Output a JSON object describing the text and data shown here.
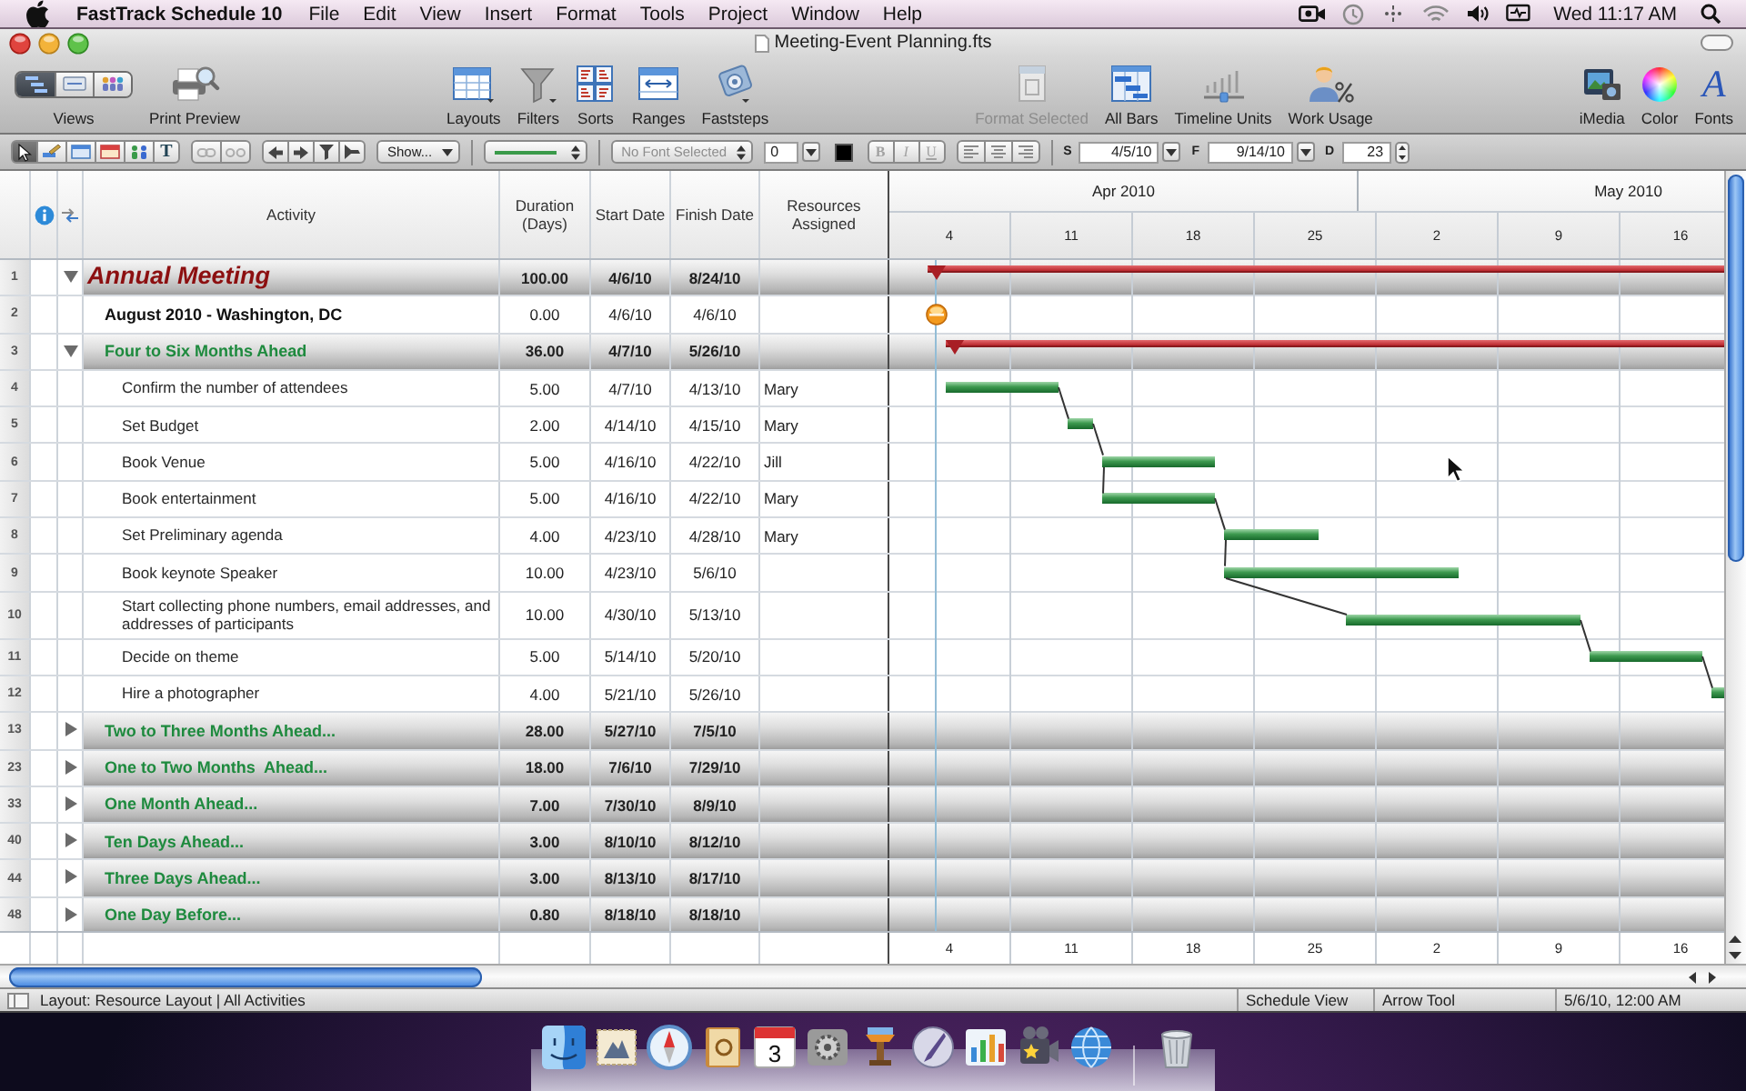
{
  "menu_bar": {
    "app_name": "FastTrack Schedule 10",
    "menus": [
      "File",
      "Edit",
      "View",
      "Insert",
      "Format",
      "Tools",
      "Project",
      "Window",
      "Help"
    ],
    "clock": "Wed 11:17 AM"
  },
  "window": {
    "title": "Meeting-Event Planning.fts"
  },
  "toolbar": {
    "groups": [
      {
        "items": [
          {
            "kind": "views",
            "label": "Views",
            "segments": [
              {
                "kind": "gantt",
                "selected": true
              },
              {
                "kind": "cards",
                "selected": false
              },
              {
                "kind": "people",
                "selected": false
              }
            ]
          },
          {
            "kind": "print",
            "label": "Print Preview"
          }
        ]
      },
      {
        "items": [
          {
            "kind": "layouts",
            "label": "Layouts"
          },
          {
            "kind": "filters",
            "label": "Filters"
          },
          {
            "kind": "sorts",
            "label": "Sorts"
          },
          {
            "kind": "ranges",
            "label": "Ranges"
          },
          {
            "kind": "faststeps",
            "label": "Faststeps"
          }
        ]
      },
      {
        "items": [
          {
            "kind": "format",
            "label": "Format Selected",
            "disabled": true
          },
          {
            "kind": "bars",
            "label": "All Bars",
            "disabled": false
          },
          {
            "kind": "timeline",
            "label": "Timeline Units",
            "disabled": false
          },
          {
            "kind": "usage",
            "label": "Work Usage",
            "disabled": false
          }
        ]
      },
      {
        "items": [
          {
            "kind": "media",
            "label": "iMedia"
          },
          {
            "kind": "color",
            "label": "Color"
          },
          {
            "kind": "fonts",
            "label": "Fonts",
            "glyph": "A"
          }
        ]
      }
    ]
  },
  "format_bar": {
    "tools": [
      {
        "kind": "pointer",
        "selected": true
      },
      {
        "kind": "pen",
        "selected": false
      },
      {
        "kind": "card",
        "selected": false
      },
      {
        "kind": "flag",
        "selected": false
      },
      {
        "kind": "people",
        "selected": false
      },
      {
        "kind": "text",
        "glyph": "T",
        "selected": false
      }
    ],
    "link_buttons": [
      {
        "kind": "link",
        "disabled": true
      },
      {
        "kind": "unlink",
        "disabled": true
      }
    ],
    "nav_buttons": [
      {
        "kind": "left"
      },
      {
        "kind": "right"
      },
      {
        "kind": "filter-down"
      },
      {
        "kind": "filter-right"
      }
    ],
    "show_menu": "Show...",
    "font_menu": "No Font Selected",
    "font_size": "0",
    "style_buttons": [
      {
        "kind": "bold",
        "label": "B",
        "disabled": true
      },
      {
        "kind": "italic",
        "label": "I",
        "disabled": true
      },
      {
        "kind": "underline",
        "label": "U",
        "disabled": true
      }
    ],
    "align_buttons": [
      {
        "kind": "left"
      },
      {
        "kind": "center"
      },
      {
        "kind": "right"
      }
    ],
    "date_fields": [
      {
        "kind": "date",
        "label": "S",
        "value": "4/5/10"
      },
      {
        "kind": "date",
        "label": "F",
        "value": "9/14/10"
      },
      {
        "kind": "number",
        "label": "D",
        "value": "23"
      }
    ]
  },
  "schedule": {
    "columns": [
      "Activity",
      "Duration (Days)",
      "Start Date",
      "Finish Date",
      "Resources Assigned"
    ],
    "timeline": {
      "months": [
        "Apr 2010",
        "May 2010"
      ],
      "weeks": [
        "4",
        "11",
        "18",
        "25",
        "2",
        "9",
        "16"
      ]
    },
    "rows": [
      {
        "number": "1",
        "kind": "project",
        "expanded": true,
        "activity": "Annual Meeting",
        "duration": "100.00",
        "start": "4/6/10",
        "finish": "8/24/10",
        "children": [
          {
            "number": "2",
            "kind": "milestone",
            "activity": "August 2010 - Washington, DC",
            "duration": "0.00",
            "start": "4/6/10",
            "finish": "4/6/10"
          },
          {
            "number": "3",
            "kind": "summary",
            "expanded": true,
            "activity": "Four to Six Months Ahead",
            "duration": "36.00",
            "start": "4/7/10",
            "finish": "5/26/10",
            "children": [
              {
                "number": "4",
                "kind": "task",
                "linked": false,
                "activity": "Confirm the number of attendees",
                "duration": "5.00",
                "start": "4/7/10",
                "finish": "4/13/10",
                "resource": "Mary"
              },
              {
                "number": "5",
                "kind": "task",
                "linked": true,
                "activity": "Set Budget",
                "duration": "2.00",
                "start": "4/14/10",
                "finish": "4/15/10",
                "resource": "Mary"
              },
              {
                "number": "6",
                "kind": "task",
                "linked": true,
                "activity": "Book Venue",
                "duration": "5.00",
                "start": "4/16/10",
                "finish": "4/22/10",
                "resource": "Jill"
              },
              {
                "number": "7",
                "kind": "task",
                "linked": true,
                "activity": "Book entertainment",
                "duration": "5.00",
                "start": "4/16/10",
                "finish": "4/22/10",
                "resource": "Mary"
              },
              {
                "number": "8",
                "kind": "task",
                "linked": true,
                "activity": "Set Preliminary agenda",
                "duration": "4.00",
                "start": "4/23/10",
                "finish": "4/28/10",
                "resource": "Mary"
              },
              {
                "number": "9",
                "kind": "task",
                "linked": true,
                "activity": "Book keynote Speaker",
                "duration": "10.00",
                "start": "4/23/10",
                "finish": "5/6/10"
              },
              {
                "number": "10",
                "kind": "task",
                "linked": true,
                "activity": "Start collecting phone numbers, email addresses, and addresses of participants",
                "duration": "10.00",
                "start": "4/30/10",
                "finish": "5/13/10"
              },
              {
                "number": "11",
                "kind": "task",
                "linked": true,
                "activity": "Decide on theme",
                "duration": "5.00",
                "start": "5/14/10",
                "finish": "5/20/10"
              },
              {
                "number": "12",
                "kind": "task",
                "linked": true,
                "activity": "Hire a photographer",
                "duration": "4.00",
                "start": "5/21/10",
                "finish": "5/26/10"
              }
            ]
          },
          {
            "number": "13",
            "kind": "summary",
            "expanded": false,
            "activity": "Two to Three Months Ahead...",
            "duration": "28.00",
            "start": "5/27/10",
            "finish": "7/5/10"
          },
          {
            "number": "23",
            "kind": "summary",
            "expanded": false,
            "activity": "One to Two Months  Ahead...",
            "duration": "18.00",
            "start": "7/6/10",
            "finish": "7/29/10"
          },
          {
            "number": "33",
            "kind": "summary",
            "expanded": false,
            "activity": "One Month Ahead...",
            "duration": "7.00",
            "start": "7/30/10",
            "finish": "8/9/10"
          },
          {
            "number": "40",
            "kind": "summary",
            "expanded": false,
            "activity": "Ten Days Ahead...",
            "duration": "3.00",
            "start": "8/10/10",
            "finish": "8/12/10"
          },
          {
            "number": "44",
            "kind": "summary",
            "expanded": false,
            "activity": "Three Days Ahead...",
            "duration": "3.00",
            "start": "8/13/10",
            "finish": "8/17/10"
          },
          {
            "number": "48",
            "kind": "summary",
            "expanded": false,
            "activity": "One Day Before...",
            "duration": "0.80",
            "start": "8/18/10",
            "finish": "8/18/10"
          }
        ]
      }
    ],
    "footer_weeks": [
      "4",
      "11",
      "18",
      "25",
      "2",
      "9",
      "16"
    ]
  },
  "status_bar": {
    "layout": "Layout: Resource Layout | All Activities",
    "panes": [
      "Schedule View",
      "Arrow Tool",
      "5/6/10, 12:00 AM"
    ]
  },
  "dock": {
    "items": [
      {
        "kind": "finder"
      },
      {
        "kind": "stamp"
      },
      {
        "kind": "compass"
      },
      {
        "kind": "book"
      },
      {
        "kind": "calendar",
        "text": "3"
      },
      {
        "kind": "gear"
      },
      {
        "kind": "lectern"
      },
      {
        "kind": "quill"
      },
      {
        "kind": "chart"
      },
      {
        "kind": "movie"
      },
      {
        "kind": "globe"
      },
      {
        "kind": "trash"
      }
    ]
  }
}
